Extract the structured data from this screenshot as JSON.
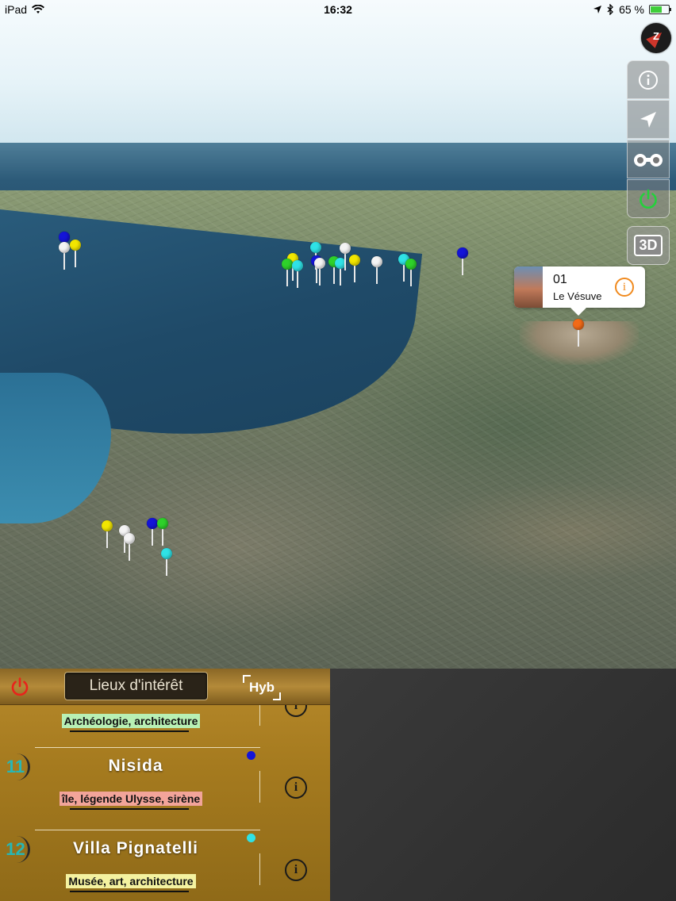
{
  "status_bar": {
    "device": "iPad",
    "time": "16:32",
    "battery": "65 %",
    "battery_level": 0.65
  },
  "map": {
    "icons": {
      "compass": "compass-icon",
      "info": "info-icon",
      "locate": "location-arrow-icon",
      "binoculars": "binoculars-icon",
      "power": "power-icon"
    },
    "btn_3d_label": "3D",
    "callout": {
      "number": "01",
      "name": "Le Vésuve"
    },
    "pin_colors": {
      "blue": "#1414d8",
      "white": "#f4f4f4",
      "yellow": "#f2e600",
      "cyan": "#2fe2e6",
      "green": "#2ed12a",
      "orange": "#f26a17"
    }
  },
  "panel": {
    "tab_title": "Lieux d'intérêt",
    "map_mode": "Hyb",
    "items": [
      {
        "number": "",
        "title": "",
        "tags": "Archéologie, architecture",
        "tag_color": "#b8f0b4",
        "dot_color": ""
      },
      {
        "number": "11",
        "title": "Nisida",
        "tags": "île, légende Ulysse, sirène",
        "tag_color": "#f2a49a",
        "dot_color": "#1414d8"
      },
      {
        "number": "12",
        "title": "Villa Pignatelli",
        "tags": "Musée, art, architecture",
        "tag_color": "#f4f2a0",
        "dot_color": "#2fe2e6"
      }
    ],
    "info_glyph": "i"
  }
}
